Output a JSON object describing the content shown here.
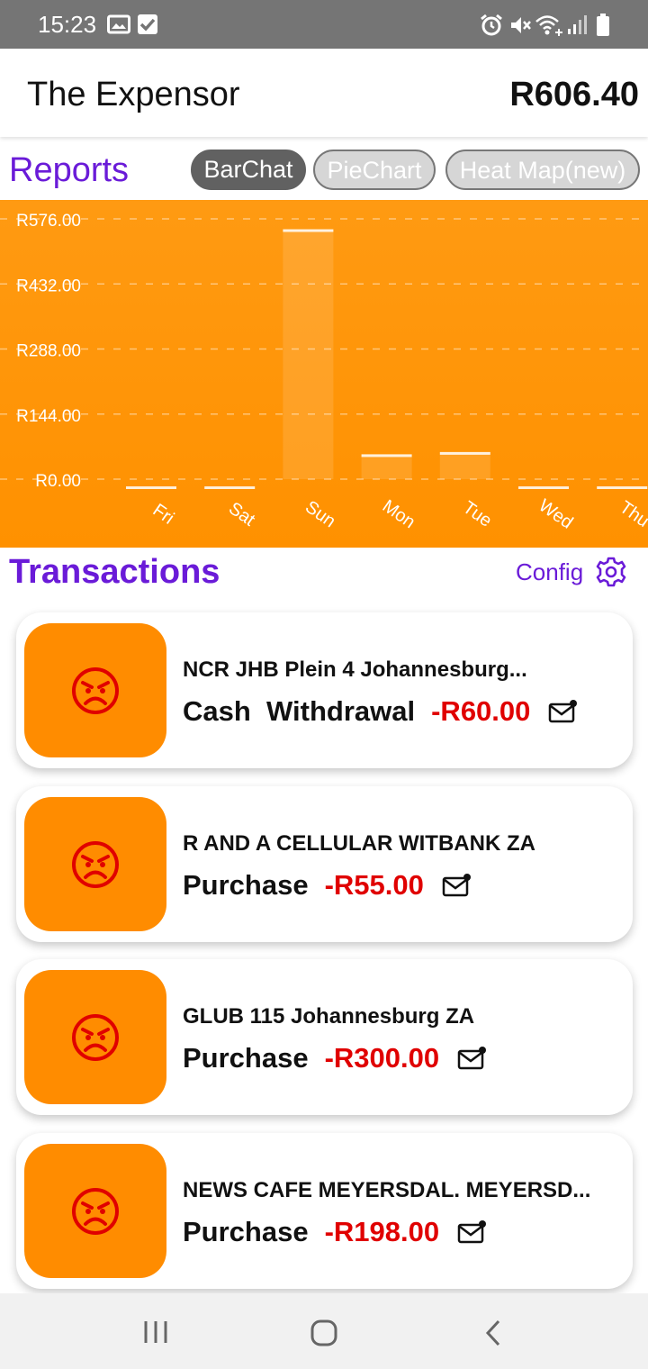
{
  "status_bar": {
    "time": "15:23",
    "left_icons": [
      "gallery-icon",
      "checkbox-icon"
    ],
    "right_icons": [
      "alarm-icon",
      "mute-icon",
      "wifi-icon",
      "signal-icon",
      "battery-icon"
    ]
  },
  "app_bar": {
    "title": "The Expensor",
    "total": "R606.40"
  },
  "reports": {
    "label": "Reports",
    "tabs": [
      {
        "label": "BarChat",
        "active": true
      },
      {
        "label": "PieChart",
        "active": false
      },
      {
        "label": "Heat Map(new)",
        "active": false
      }
    ]
  },
  "chart_data": {
    "type": "bar",
    "categories": [
      "Fri",
      "Sat",
      "Sun",
      "Mon",
      "Tue",
      "Wed",
      "Thu"
    ],
    "values": [
      0,
      0,
      553,
      55,
      60,
      0,
      0
    ],
    "y_ticks": [
      "R576.00",
      "R432.00",
      "R288.00",
      "R144.00",
      "R0.00"
    ],
    "ylim": [
      0,
      576
    ],
    "grid": true,
    "background": "#ff9100"
  },
  "transactions": {
    "label": "Transactions",
    "config_label": "Config",
    "items": [
      {
        "merchant": "NCR JHB Plein 4 Johannesburg...",
        "type": "Cash  Withdrawal",
        "amount": "-R60.00",
        "mood_icon": "angry-face-icon"
      },
      {
        "merchant": "R AND A CELLULAR WITBANK ZA",
        "type": "Purchase",
        "amount": "-R55.00",
        "mood_icon": "angry-face-icon"
      },
      {
        "merchant": "GLUB 115 Johannesburg ZA",
        "type": "Purchase",
        "amount": "-R300.00",
        "mood_icon": "angry-face-icon"
      },
      {
        "merchant": "NEWS CAFE MEYERSDAL. MEYERSD...",
        "type": "Purchase",
        "amount": "-R198.00",
        "mood_icon": "angry-face-icon"
      }
    ]
  },
  "colors": {
    "accent_purple": "#6a1bd8",
    "amount_red": "#e00000",
    "orange": "#ff8c00"
  },
  "nav_bar": [
    "recent-apps-icon",
    "home-icon",
    "back-icon"
  ]
}
